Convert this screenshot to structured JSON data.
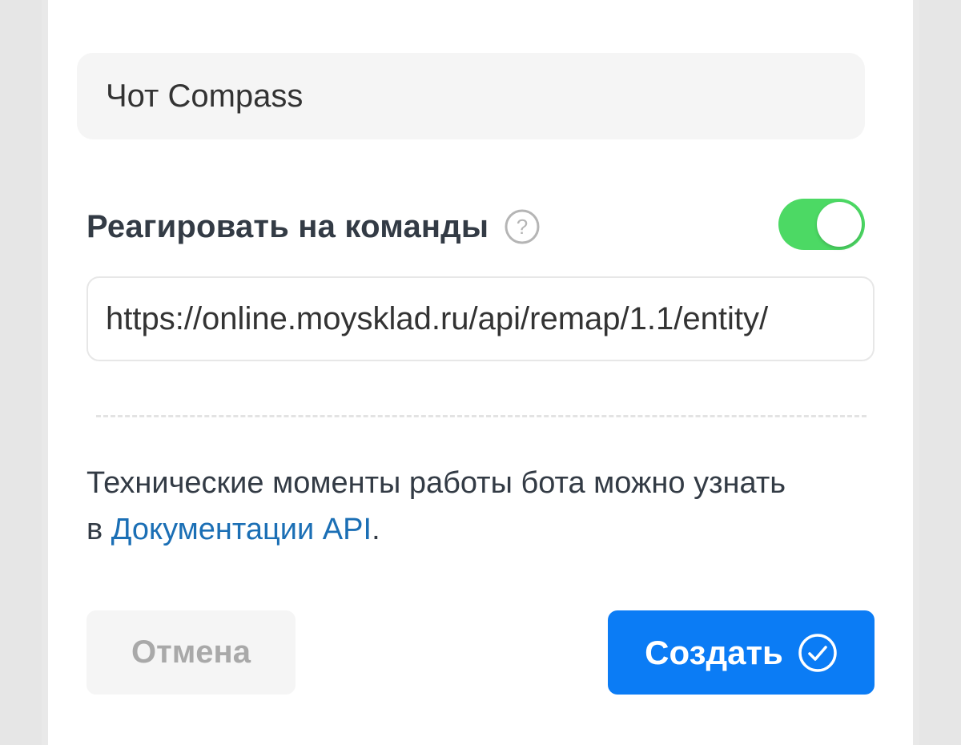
{
  "form": {
    "bot_name_value": "Чот Compass",
    "react_commands_label": "Реагировать на команды",
    "react_commands_enabled": true,
    "webhook_url_value": "https://online.moysklad.ru/api/remap/1.1/entity/",
    "info_text_before": "Технические моменты работы бота можно узнать в ",
    "info_link_text": "Документации API",
    "info_text_after": ".",
    "cancel_label": "Отмена",
    "create_label": "Создать"
  },
  "icons": {
    "help": "question-circle-icon",
    "create": "check-circle-icon"
  },
  "colors": {
    "toggle_on": "#4cd964",
    "primary": "#0b7cf5",
    "link": "#1b6fb5"
  }
}
